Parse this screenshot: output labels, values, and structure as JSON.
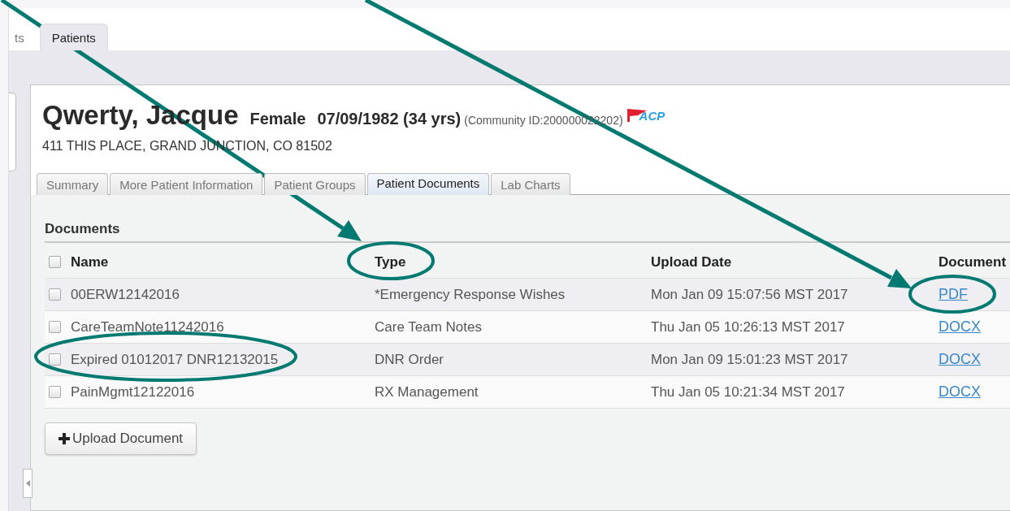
{
  "top_tabs": [
    {
      "label": "ts",
      "selected": false
    },
    {
      "label": "Patients",
      "selected": true
    }
  ],
  "patient": {
    "name": "Qwerty, Jacque",
    "gender": "Female",
    "dob": "07/09/1982 (34 yrs)",
    "community_id": "(Community ID:200000022202)",
    "badge": "ACP",
    "address": "411 THIS PLACE, GRAND JUNCTION, CO 81502"
  },
  "tabs": [
    {
      "label": "Summary",
      "selected": false
    },
    {
      "label": "More Patient Information",
      "selected": false
    },
    {
      "label": "Patient Groups",
      "selected": false
    },
    {
      "label": "Patient Documents",
      "selected": true
    },
    {
      "label": "Lab Charts",
      "selected": false
    }
  ],
  "documents": {
    "title": "Documents",
    "select_all_checked": false,
    "columns": [
      "Name",
      "Type",
      "Upload Date",
      "Document"
    ],
    "rows": [
      {
        "checked": false,
        "name": "00ERW12142016",
        "type": "*Emergency Response Wishes",
        "upload_date": "Mon Jan 09 15:07:56 MST 2017",
        "document": "PDF"
      },
      {
        "checked": false,
        "name": "CareTeamNote11242016",
        "type": "Care Team Notes",
        "upload_date": "Thu Jan 05 10:26:13 MST 2017",
        "document": "DOCX"
      },
      {
        "checked": false,
        "name": "Expired 01012017 DNR12132015",
        "type": "DNR Order",
        "upload_date": "Mon Jan 09 15:01:23 MST 2017",
        "document": "DOCX"
      },
      {
        "checked": false,
        "name": "PainMgmt12122016",
        "type": "RX Management",
        "upload_date": "Thu Jan 05 10:21:34 MST 2017",
        "document": "DOCX"
      }
    ],
    "upload_button": "Upload Document"
  }
}
